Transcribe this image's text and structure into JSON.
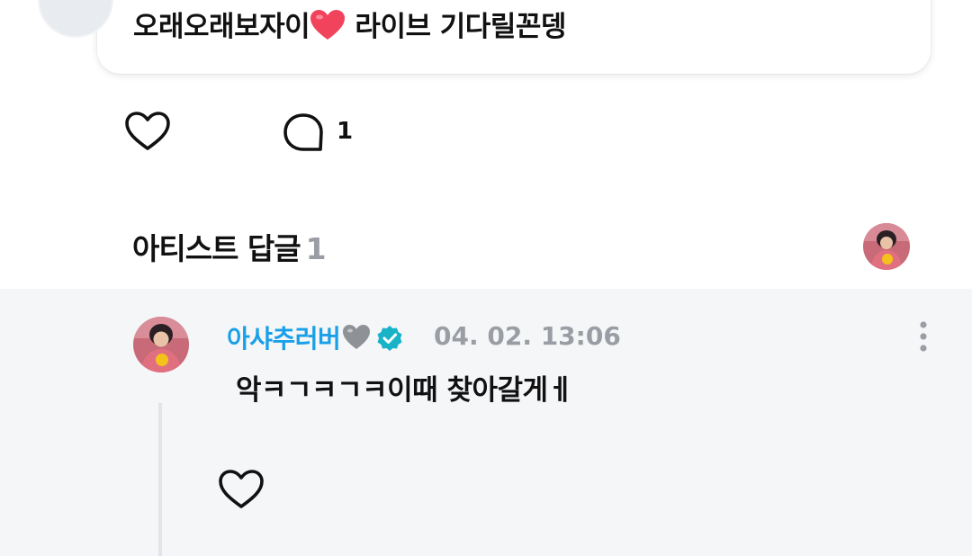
{
  "top_comment": {
    "text_before": "오래오래보자이",
    "text_after": " 라이브 기다릴꼰뎅",
    "emoji_icon": "red-heart-emoji",
    "avatar_icon": "default-avatar-icon"
  },
  "actions": {
    "like_icon": "heart-outline-icon",
    "comment_icon": "comment-bubble-icon",
    "comment_count": "1"
  },
  "artist_replies": {
    "title": "아티스트 답글",
    "count": "1"
  },
  "reply": {
    "author": "아샤추러버",
    "author_emoji": "grey-heart-emoji",
    "verified_icon": "verified-badge-icon",
    "timestamp": "04. 02. 13:06",
    "text": "악ㅋㄱㅋㄱㅋ이때 찾아갈게ㅔ",
    "more_icon": "more-vertical-icon",
    "like_icon": "heart-outline-icon"
  },
  "colors": {
    "author_blue": "#1aa0e8",
    "verified_teal": "#19b3c8",
    "muted_grey": "#9a9ea4",
    "panel_bg": "#f5f6f8"
  }
}
